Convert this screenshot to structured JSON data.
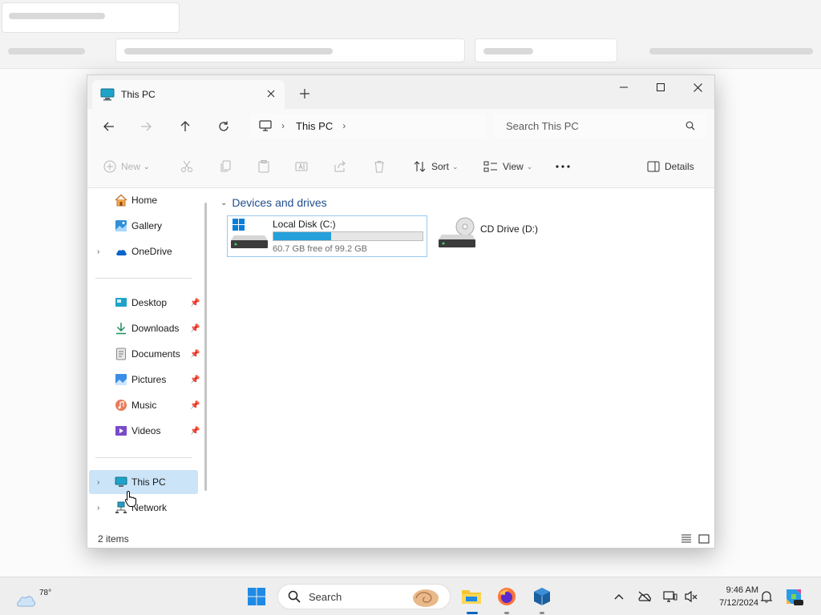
{
  "explorer": {
    "tab_title": "This PC",
    "address": {
      "location": "This PC"
    },
    "search_placeholder": "Search This PC",
    "commands": {
      "new": "New",
      "sort": "Sort",
      "view": "View",
      "details": "Details"
    },
    "nav": {
      "top": [
        {
          "label": "Home",
          "icon": "home-icon"
        },
        {
          "label": "Gallery",
          "icon": "gallery-icon"
        },
        {
          "label": "OneDrive",
          "icon": "onedrive-icon"
        }
      ],
      "pinned": [
        {
          "label": "Desktop",
          "icon": "desktop-folder-icon"
        },
        {
          "label": "Downloads",
          "icon": "downloads-icon"
        },
        {
          "label": "Documents",
          "icon": "documents-icon"
        },
        {
          "label": "Pictures",
          "icon": "pictures-icon"
        },
        {
          "label": "Music",
          "icon": "music-icon"
        },
        {
          "label": "Videos",
          "icon": "videos-icon"
        }
      ],
      "bottom": [
        {
          "label": "This PC",
          "icon": "this-pc-icon",
          "selected": true
        },
        {
          "label": "Network",
          "icon": "network-icon"
        }
      ]
    },
    "content": {
      "group_label": "Devices and drives",
      "drives": [
        {
          "name": "Local Disk (C:)",
          "free_text": "60.7 GB free of 99.2 GB",
          "used_fraction": 0.388
        },
        {
          "name": "CD Drive (D:)"
        }
      ]
    },
    "status_text": "2 items"
  },
  "taskbar": {
    "weather_temp": "78°",
    "search_label": "Search",
    "time": "9:46 AM",
    "date": "7/12/2024"
  },
  "colors": {
    "accent": "#0067c0",
    "drive_fill": "#26a0da",
    "selection": "#cce4f7"
  }
}
